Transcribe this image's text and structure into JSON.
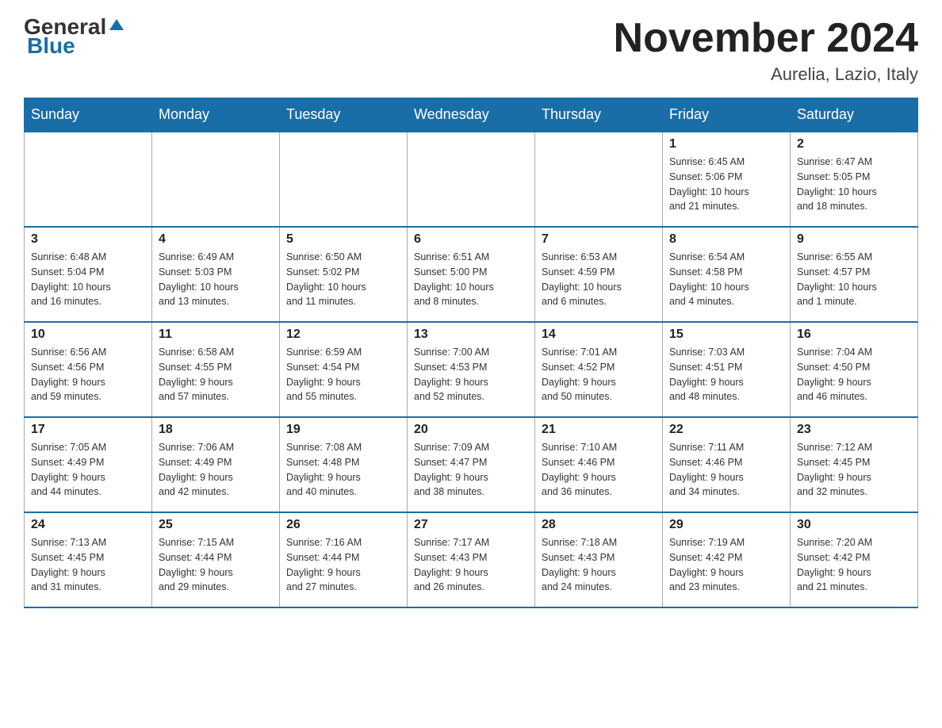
{
  "header": {
    "logo_general": "General",
    "logo_blue": "Blue",
    "month_title": "November 2024",
    "location": "Aurelia, Lazio, Italy"
  },
  "weekdays": [
    "Sunday",
    "Monday",
    "Tuesday",
    "Wednesday",
    "Thursday",
    "Friday",
    "Saturday"
  ],
  "weeks": [
    [
      {
        "day": "",
        "info": ""
      },
      {
        "day": "",
        "info": ""
      },
      {
        "day": "",
        "info": ""
      },
      {
        "day": "",
        "info": ""
      },
      {
        "day": "",
        "info": ""
      },
      {
        "day": "1",
        "info": "Sunrise: 6:45 AM\nSunset: 5:06 PM\nDaylight: 10 hours\nand 21 minutes."
      },
      {
        "day": "2",
        "info": "Sunrise: 6:47 AM\nSunset: 5:05 PM\nDaylight: 10 hours\nand 18 minutes."
      }
    ],
    [
      {
        "day": "3",
        "info": "Sunrise: 6:48 AM\nSunset: 5:04 PM\nDaylight: 10 hours\nand 16 minutes."
      },
      {
        "day": "4",
        "info": "Sunrise: 6:49 AM\nSunset: 5:03 PM\nDaylight: 10 hours\nand 13 minutes."
      },
      {
        "day": "5",
        "info": "Sunrise: 6:50 AM\nSunset: 5:02 PM\nDaylight: 10 hours\nand 11 minutes."
      },
      {
        "day": "6",
        "info": "Sunrise: 6:51 AM\nSunset: 5:00 PM\nDaylight: 10 hours\nand 8 minutes."
      },
      {
        "day": "7",
        "info": "Sunrise: 6:53 AM\nSunset: 4:59 PM\nDaylight: 10 hours\nand 6 minutes."
      },
      {
        "day": "8",
        "info": "Sunrise: 6:54 AM\nSunset: 4:58 PM\nDaylight: 10 hours\nand 4 minutes."
      },
      {
        "day": "9",
        "info": "Sunrise: 6:55 AM\nSunset: 4:57 PM\nDaylight: 10 hours\nand 1 minute."
      }
    ],
    [
      {
        "day": "10",
        "info": "Sunrise: 6:56 AM\nSunset: 4:56 PM\nDaylight: 9 hours\nand 59 minutes."
      },
      {
        "day": "11",
        "info": "Sunrise: 6:58 AM\nSunset: 4:55 PM\nDaylight: 9 hours\nand 57 minutes."
      },
      {
        "day": "12",
        "info": "Sunrise: 6:59 AM\nSunset: 4:54 PM\nDaylight: 9 hours\nand 55 minutes."
      },
      {
        "day": "13",
        "info": "Sunrise: 7:00 AM\nSunset: 4:53 PM\nDaylight: 9 hours\nand 52 minutes."
      },
      {
        "day": "14",
        "info": "Sunrise: 7:01 AM\nSunset: 4:52 PM\nDaylight: 9 hours\nand 50 minutes."
      },
      {
        "day": "15",
        "info": "Sunrise: 7:03 AM\nSunset: 4:51 PM\nDaylight: 9 hours\nand 48 minutes."
      },
      {
        "day": "16",
        "info": "Sunrise: 7:04 AM\nSunset: 4:50 PM\nDaylight: 9 hours\nand 46 minutes."
      }
    ],
    [
      {
        "day": "17",
        "info": "Sunrise: 7:05 AM\nSunset: 4:49 PM\nDaylight: 9 hours\nand 44 minutes."
      },
      {
        "day": "18",
        "info": "Sunrise: 7:06 AM\nSunset: 4:49 PM\nDaylight: 9 hours\nand 42 minutes."
      },
      {
        "day": "19",
        "info": "Sunrise: 7:08 AM\nSunset: 4:48 PM\nDaylight: 9 hours\nand 40 minutes."
      },
      {
        "day": "20",
        "info": "Sunrise: 7:09 AM\nSunset: 4:47 PM\nDaylight: 9 hours\nand 38 minutes."
      },
      {
        "day": "21",
        "info": "Sunrise: 7:10 AM\nSunset: 4:46 PM\nDaylight: 9 hours\nand 36 minutes."
      },
      {
        "day": "22",
        "info": "Sunrise: 7:11 AM\nSunset: 4:46 PM\nDaylight: 9 hours\nand 34 minutes."
      },
      {
        "day": "23",
        "info": "Sunrise: 7:12 AM\nSunset: 4:45 PM\nDaylight: 9 hours\nand 32 minutes."
      }
    ],
    [
      {
        "day": "24",
        "info": "Sunrise: 7:13 AM\nSunset: 4:45 PM\nDaylight: 9 hours\nand 31 minutes."
      },
      {
        "day": "25",
        "info": "Sunrise: 7:15 AM\nSunset: 4:44 PM\nDaylight: 9 hours\nand 29 minutes."
      },
      {
        "day": "26",
        "info": "Sunrise: 7:16 AM\nSunset: 4:44 PM\nDaylight: 9 hours\nand 27 minutes."
      },
      {
        "day": "27",
        "info": "Sunrise: 7:17 AM\nSunset: 4:43 PM\nDaylight: 9 hours\nand 26 minutes."
      },
      {
        "day": "28",
        "info": "Sunrise: 7:18 AM\nSunset: 4:43 PM\nDaylight: 9 hours\nand 24 minutes."
      },
      {
        "day": "29",
        "info": "Sunrise: 7:19 AM\nSunset: 4:42 PM\nDaylight: 9 hours\nand 23 minutes."
      },
      {
        "day": "30",
        "info": "Sunrise: 7:20 AM\nSunset: 4:42 PM\nDaylight: 9 hours\nand 21 minutes."
      }
    ]
  ]
}
